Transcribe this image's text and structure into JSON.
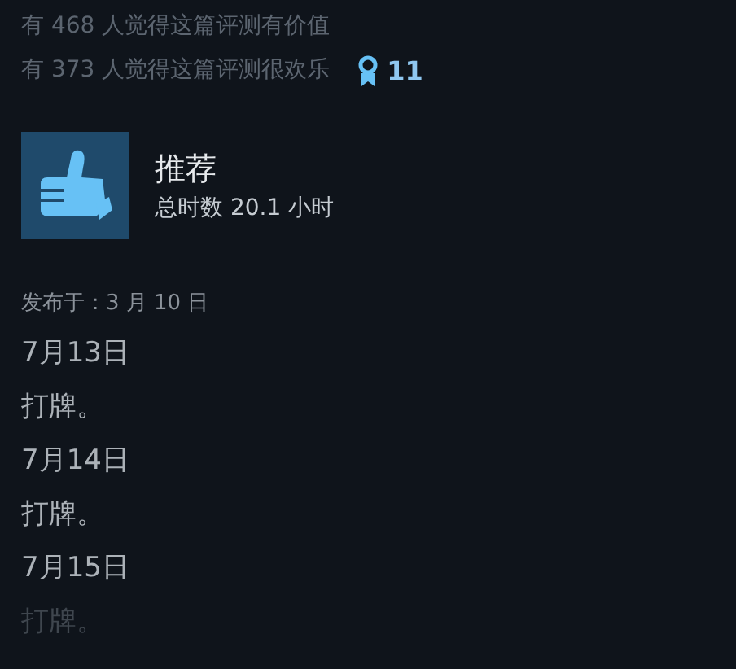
{
  "votes": [
    {
      "text": "有 468 人觉得这篇评测有价值"
    },
    {
      "text": "有 373 人觉得这篇评测很欢乐"
    }
  ],
  "award_count": "11",
  "verdict": "推荐",
  "playtime": "总时数 20.1 小时",
  "posted": "发布于：3 月 10 日",
  "body": [
    {
      "text": "7月13日",
      "faded": false
    },
    {
      "text": "打牌。",
      "faded": false
    },
    {
      "text": "7月14日",
      "faded": false
    },
    {
      "text": "打牌。",
      "faded": false
    },
    {
      "text": "7月15日",
      "faded": false
    },
    {
      "text": "打牌。",
      "faded": true
    }
  ]
}
